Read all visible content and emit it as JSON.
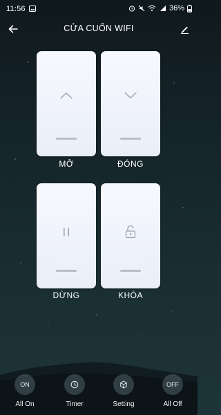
{
  "status_bar": {
    "time": "11:56",
    "battery": "36%"
  },
  "header": {
    "title": "CỬA CUỐN WIFI"
  },
  "controls": [
    {
      "label": "MỞ",
      "icon": "chevron-up-icon"
    },
    {
      "label": "ĐÓNG",
      "icon": "chevron-down-icon"
    },
    {
      "label": "DỪNG",
      "icon": "pause-icon"
    },
    {
      "label": "KHÓA",
      "icon": "unlock-icon"
    }
  ],
  "bottom_bar": [
    {
      "label": "All On",
      "badge": "ON",
      "icon": "all-on-icon"
    },
    {
      "label": "Timer",
      "icon": "clock-icon"
    },
    {
      "label": "Setting",
      "icon": "hexagon-settings-icon"
    },
    {
      "label": "All Off",
      "badge": "OFF",
      "icon": "all-off-icon"
    }
  ],
  "colors": {
    "card_top": "#f7f9fe",
    "card_bottom": "#e9eef9",
    "icon_gray": "#9aa1ab",
    "background": "#15252a"
  }
}
